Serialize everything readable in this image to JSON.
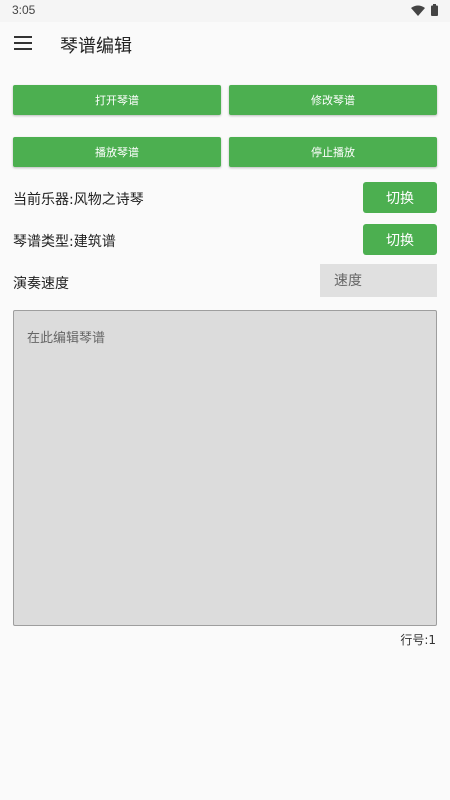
{
  "status_bar": {
    "time": "3:05"
  },
  "app_bar": {
    "title": "琴谱编辑"
  },
  "buttons": {
    "open": "打开琴谱",
    "modify": "修改琴谱",
    "play": "播放琴谱",
    "stop": "停止播放"
  },
  "instrument": {
    "label": "当前乐器:风物之诗琴",
    "switch_label": "切换"
  },
  "score_type": {
    "label": "琴谱类型:建筑谱",
    "switch_label": "切换"
  },
  "speed": {
    "label": "演奏速度",
    "placeholder": "速度"
  },
  "editor": {
    "placeholder": "在此编辑琴谱"
  },
  "line_number": {
    "text": "行号:1"
  },
  "colors": {
    "accent": "#4caf50",
    "background": "#fafafa",
    "input_bg": "#e0e0e0"
  },
  "icons": {
    "wifi": "wifi-icon",
    "battery": "battery-icon",
    "menu": "menu-icon"
  }
}
